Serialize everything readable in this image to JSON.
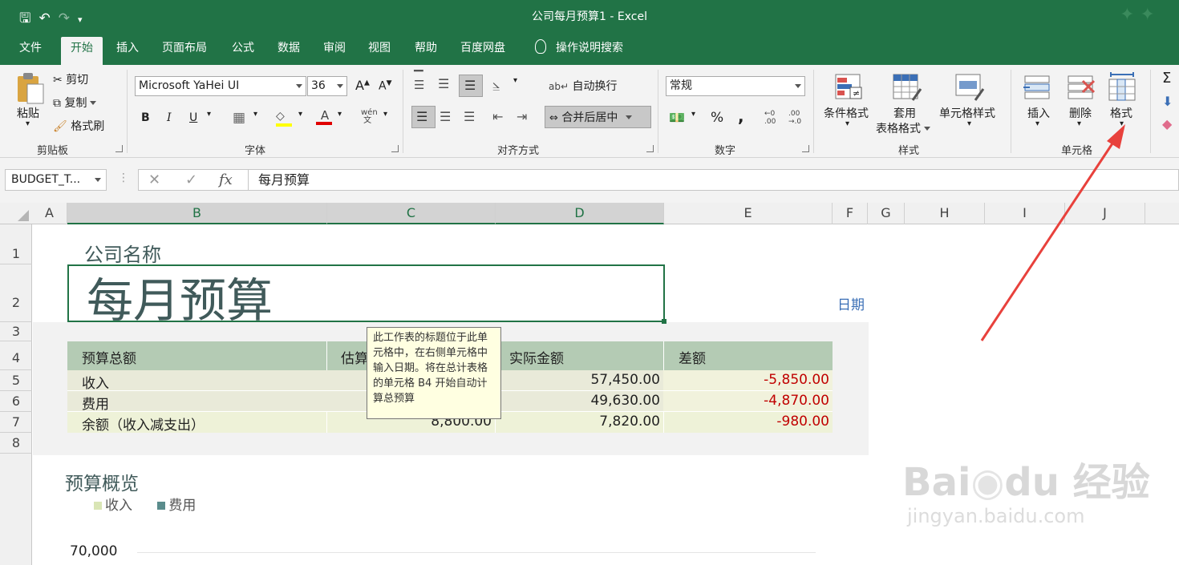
{
  "titlebar": {
    "doc_title": "公司每月预算1  -  Excel"
  },
  "tabs": [
    "文件",
    "开始",
    "插入",
    "页面布局",
    "公式",
    "数据",
    "审阅",
    "视图",
    "帮助",
    "百度网盘",
    "操作说明搜索"
  ],
  "ribbon": {
    "clipboard": {
      "paste": "粘贴",
      "cut": "剪切",
      "copy": "复制",
      "format_painter": "格式刷",
      "label": "剪贴板"
    },
    "font": {
      "name": "Microsoft YaHei UI",
      "size": "36",
      "bold": "B",
      "italic": "I",
      "underline": "U",
      "label": "字体",
      "grow": "A",
      "shrink": "A"
    },
    "alignment": {
      "wrap": "自动换行",
      "merge": "合并后居中",
      "label": "对齐方式"
    },
    "number": {
      "format": "常规",
      "percent": "%",
      "comma": ",",
      "label": "数字"
    },
    "styles": {
      "conditional": "条件格式",
      "table_1": "套用",
      "table_2": "表格格式",
      "cell_styles": "单元格样式",
      "label": "样式"
    },
    "cells": {
      "insert": "插入",
      "delete": "删除",
      "format": "格式",
      "label": "单元格"
    }
  },
  "formulabar": {
    "namebox": "BUDGET_T...",
    "fx": "fx",
    "content": "每月预算"
  },
  "columns": [
    "A",
    "B",
    "C",
    "D",
    "E",
    "F",
    "G",
    "H",
    "I",
    "J"
  ],
  "rows": [
    "1",
    "2",
    "3",
    "4",
    "5",
    "6",
    "7",
    "8"
  ],
  "sheet": {
    "company": "公司名称",
    "title": "每月预算",
    "date_label": "日期",
    "table_headers": [
      "预算总额",
      "估算",
      "实际金额",
      "差额"
    ],
    "table_rows": [
      {
        "label": "收入",
        "estimate": "",
        "actual": "57,450.00",
        "diff": "-5,850.00"
      },
      {
        "label": "费用",
        "estimate": "",
        "actual": "49,630.00",
        "diff": "-4,870.00"
      },
      {
        "label": "余额（收入减支出）",
        "estimate": "8,800.00",
        "actual": "7,820.00",
        "diff": "-980.00"
      }
    ],
    "overview_title": "预算概览",
    "legend": [
      "收入",
      "费用"
    ],
    "axis_tick": "70,000"
  },
  "tooltip": "此工作表的标题位于此单元格中，在右侧单元格中输入日期。将在总计表格的单元格 B4 开始自动计算总预算",
  "colors": {
    "accent": "#217346",
    "header_fill": "#b4cbb4",
    "row_fill": "#e9ead9",
    "income": "#d9e5b5",
    "expense": "#5a8c8c"
  }
}
